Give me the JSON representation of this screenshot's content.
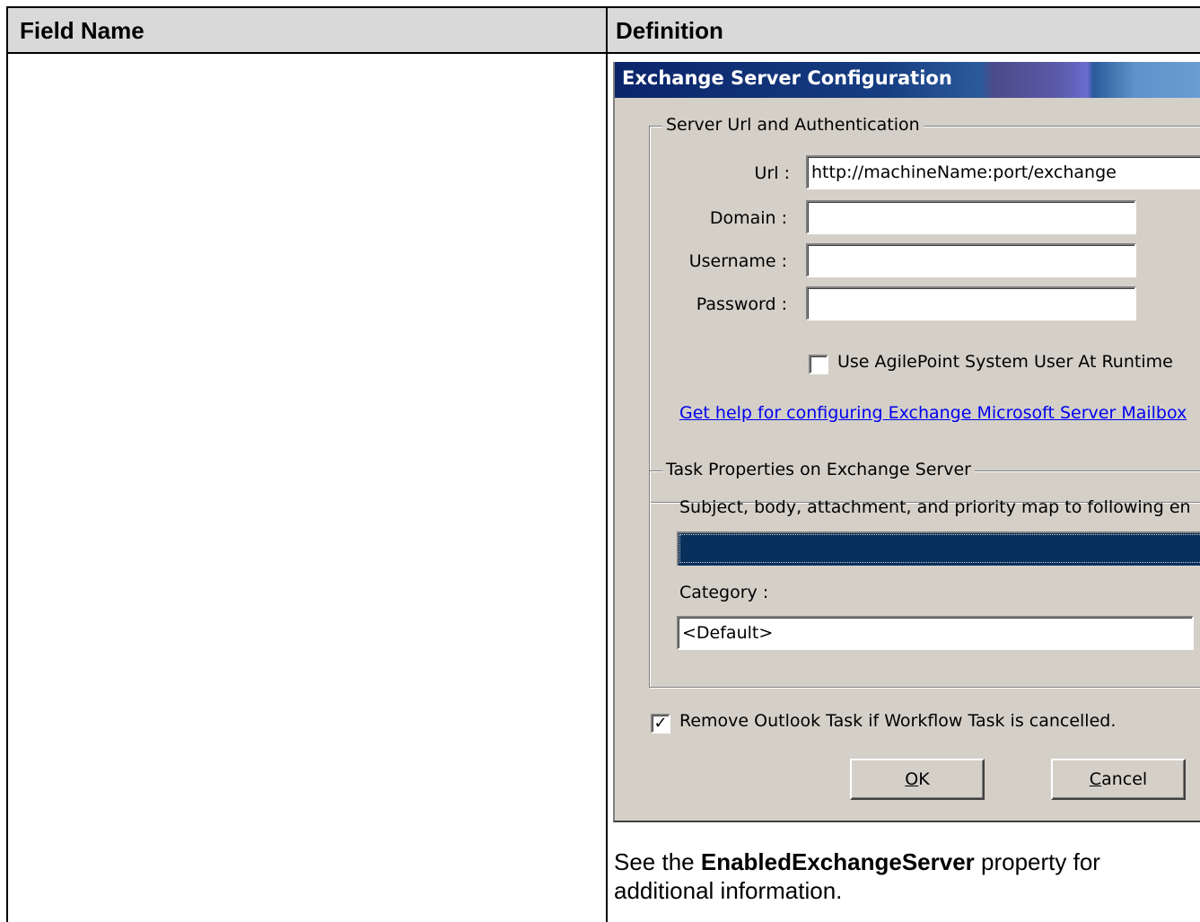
{
  "table": {
    "header_field": "Field Name",
    "header_definition": "Definition"
  },
  "dialog": {
    "title": "Exchange Server Configuration",
    "group_server": {
      "legend": "Server Url and Authentication",
      "url_label": "Url :",
      "url_value": "http://machineName:port/exchange",
      "domain_label": "Domain :",
      "domain_value": "",
      "username_label": "Username :",
      "username_value": "",
      "password_label": "Password :",
      "password_value": "",
      "use_system_user_label": "Use AgilePoint System User At Runtime",
      "use_system_user_checked": false,
      "help_link": "Get help for configuring Exchange Microsoft Server Mailbox"
    },
    "group_task": {
      "legend": "Task Properties on Exchange Server",
      "map_text": "Subject, body, attachment, and priority  map to following en",
      "category_label": "Category :",
      "category_value": "<Default>"
    },
    "remove_task_label": "Remove Outlook Task if Workflow Task is cancelled.",
    "remove_task_checked": true,
    "ok_label": "OK",
    "ok_accesskey": "O",
    "cancel_label": "Cancel",
    "cancel_accesskey": "C"
  },
  "definition_text": {
    "prefix": "See the ",
    "bold": "EnabledExchangeServer",
    "suffix": " property for additional information."
  },
  "colors": {
    "header_bg": "#d9d9d9",
    "dialog_bg": "#d4d0c8",
    "title_start": "#0a246a",
    "selection": "#07305c",
    "link": "#0000ee"
  }
}
